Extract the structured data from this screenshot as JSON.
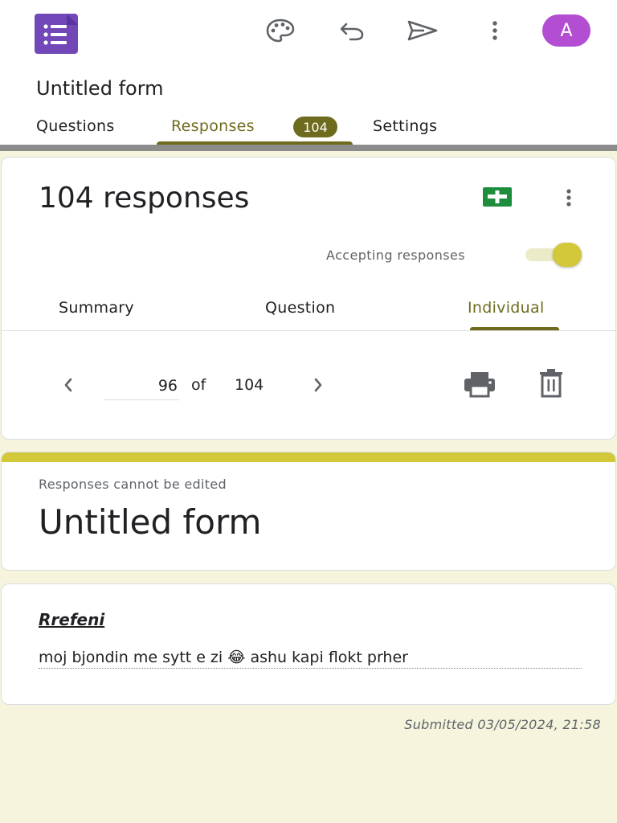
{
  "app": {
    "logo_icon": "google-forms-icon",
    "avatar_initial": "A",
    "colors": {
      "accent": "#6e6b1e",
      "highlight": "#d2c83a",
      "avatar": "#b34dd1",
      "sheets": "#1e8e3e",
      "background": "#f6f4dc"
    }
  },
  "toolbar": {
    "icons": [
      "palette-icon",
      "undo-icon",
      "send-icon",
      "more-vert-icon"
    ]
  },
  "header": {
    "title": "Untitled form"
  },
  "tabs": [
    {
      "label": "Questions"
    },
    {
      "label": "Responses",
      "badge": "104",
      "active": true
    },
    {
      "label": "Settings"
    }
  ],
  "responses": {
    "count_label": "104 responses",
    "accepting_label": "Accepting responses",
    "accepting_on": true,
    "subtabs": [
      {
        "label": "Summary"
      },
      {
        "label": "Question"
      },
      {
        "label": "Individual",
        "active": true
      }
    ],
    "pager": {
      "current": "96",
      "of_label": "of",
      "total": "104"
    }
  },
  "form_card": {
    "notice": "Responses cannot be edited",
    "title": "Untitled form"
  },
  "answer_card": {
    "question": "Rrefeni",
    "answer": "moj bjondin me sytt e zi 😂 ashu kapi flokt prher"
  },
  "footer": {
    "submitted": "Submitted 03/05/2024, 21:58"
  }
}
